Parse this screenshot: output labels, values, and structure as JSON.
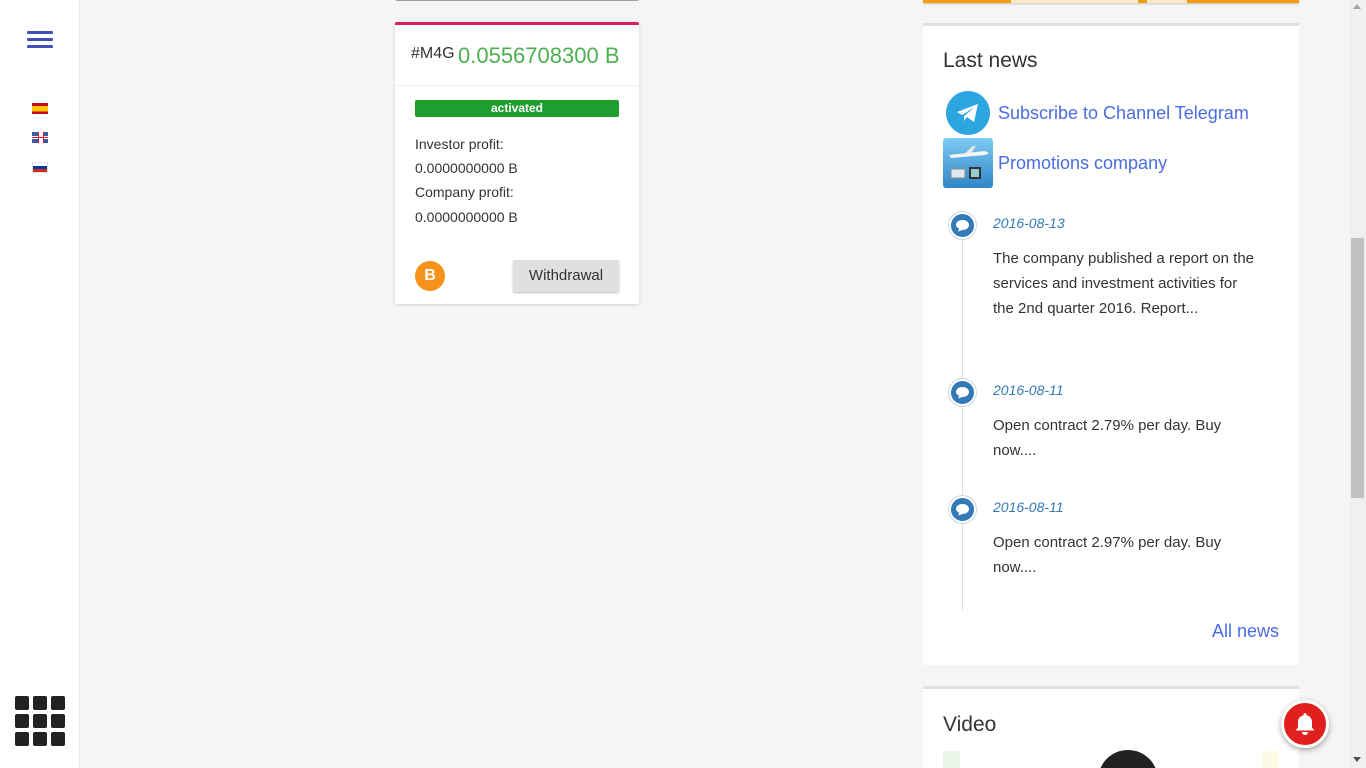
{
  "sidebar": {
    "languages": [
      "es",
      "gb",
      "ru"
    ]
  },
  "contract": {
    "id": "#M4G",
    "amount": "0.0556708300 B",
    "status": "activated",
    "investor_profit_label": "Investor profit:",
    "investor_profit_value": "0.0000000000 B",
    "company_profit_label": "Company profit:",
    "company_profit_value": "0.0000000000 B",
    "currency_icon": "B",
    "withdraw_label": "Withdrawal"
  },
  "news": {
    "title": "Last news",
    "promos": [
      {
        "label": "Subscribe to Channel Telegram",
        "icon": "telegram-icon"
      },
      {
        "label": "Promotions company",
        "icon": "promotions-image"
      }
    ],
    "items": [
      {
        "date": "2016-08-13",
        "text": "The company published a report on the services and investment activities for the 2nd quarter 2016. Report..."
      },
      {
        "date": "2016-08-11",
        "text": "Open contract 2.79% per day. Buy now...."
      },
      {
        "date": "2016-08-11",
        "text": "Open contract 2.97% per day. Buy now...."
      }
    ],
    "all_news_label": "All news"
  },
  "video": {
    "title": "Video"
  },
  "colors": {
    "accent": "#3f51b5",
    "card_top": "#d81b60",
    "amount": "#4caf50",
    "status": "#1e9e2c",
    "link": "#4a6ce0",
    "timeline": "#337ab7",
    "bell": "#e0201e"
  }
}
